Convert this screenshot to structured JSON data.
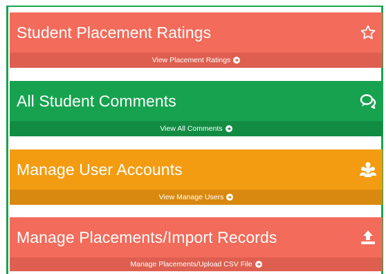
{
  "panels": [
    {
      "title": "Student Placement Ratings",
      "link": "View Placement Ratings",
      "icon": "star-icon",
      "head_color": "#f26b5b",
      "foot_color": "#de5f50"
    },
    {
      "title": "All Student Comments",
      "link": "View All Comments",
      "icon": "comments-icon",
      "head_color": "#17a24f",
      "foot_color": "#128c43"
    },
    {
      "title": "Manage User Accounts",
      "link": "View Manage Users",
      "icon": "users-icon",
      "head_color": "#f39c12",
      "foot_color": "#d9890f"
    },
    {
      "title": "Manage Placements/Import Records",
      "link": "Manage Placements/Upload CSV File",
      "icon": "upload-icon",
      "head_color": "#f26b5b",
      "foot_color": "#de5f50"
    }
  ]
}
